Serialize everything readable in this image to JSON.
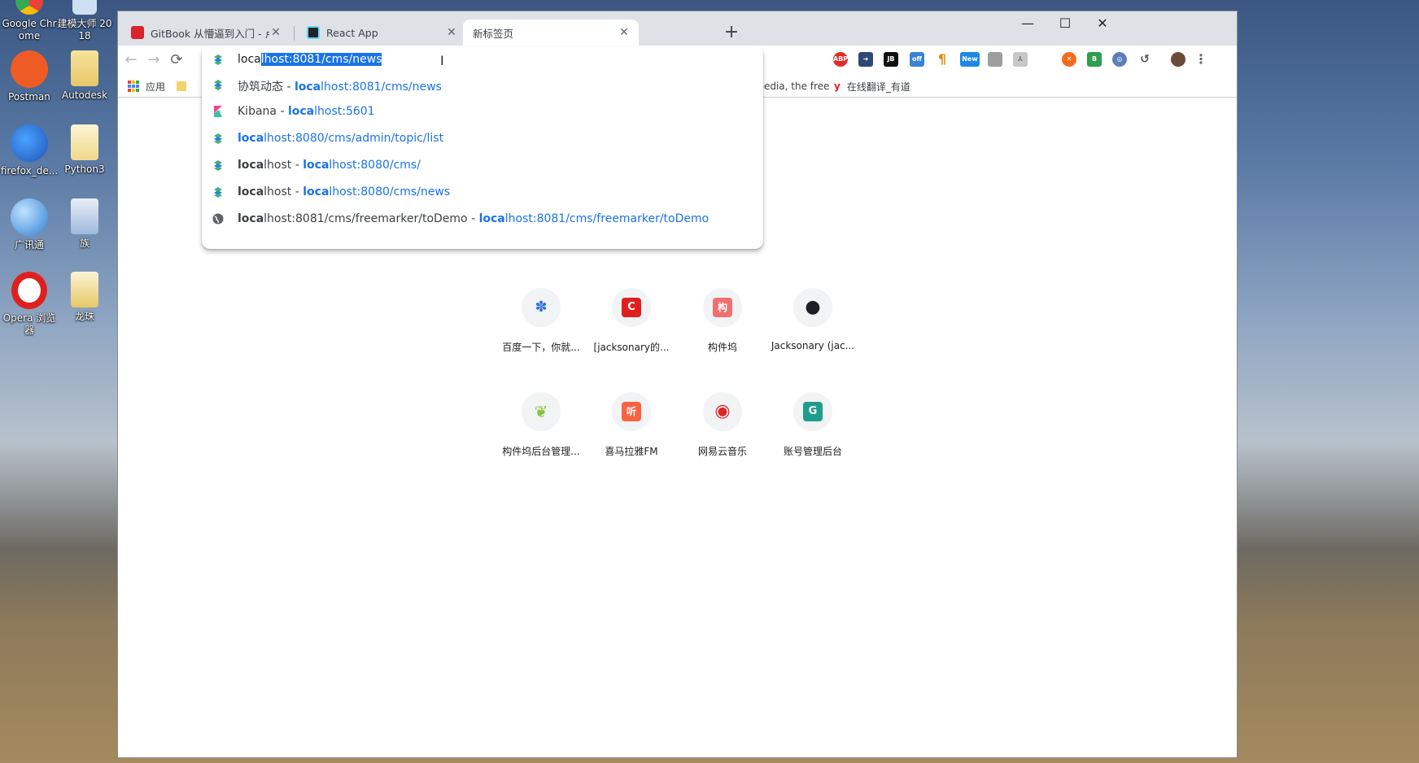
{
  "desktop": {
    "icons": [
      {
        "label": "Google Chrome",
        "color": "#f2c017"
      },
      {
        "label": "建模大师 2018",
        "color": "#d8e6f5"
      },
      {
        "label": "Postman",
        "color": "#ef5b25"
      },
      {
        "label": "Autodesk",
        "color": "#f3d36b"
      },
      {
        "label": "firefox_de...",
        "color": "#2a6fd6"
      },
      {
        "label": "Python3",
        "color": "#f3d36b"
      },
      {
        "label": "广讯通",
        "color": "#3a86d8"
      },
      {
        "label": "族",
        "color": "#6aa0d8"
      },
      {
        "label": "Opera 浏览器",
        "color": "#e0201e"
      },
      {
        "label": "龙珠",
        "color": "#f3d36b"
      }
    ]
  },
  "browser": {
    "tabs": [
      {
        "title": "GitBook 从懵逼到入门 - 卢小喵",
        "favicon_color": "#d9232d"
      },
      {
        "title": "React App",
        "favicon_color": "#20232a"
      },
      {
        "title": "新标签页",
        "favicon_color": ""
      }
    ],
    "new_tab_symbol": "+",
    "window_controls": {
      "minimize": "—",
      "maximize": "☐",
      "close": "✕"
    },
    "nav": {
      "back": "←",
      "forward": "→",
      "reload": "⟳"
    },
    "omnibox": {
      "typed": "loca",
      "selected_completion": "lhost:8081/cms/news",
      "suggestions": [
        {
          "title": "协筑动态",
          "sep": " - ",
          "url_bold": "loca",
          "url_rest": "lhost:8081/cms/news",
          "icon": "site-icon"
        },
        {
          "title": "Kibana",
          "sep": " - ",
          "url_bold": "loca",
          "url_rest": "lhost:5601",
          "icon": "kibana-icon"
        },
        {
          "title": "",
          "sep": "",
          "url_bold": "loca",
          "url_rest": "lhost:8080/cms/admin/topic/list",
          "icon": "site-icon"
        },
        {
          "title_bold": "loca",
          "title": "lhost",
          "sep": " - ",
          "url_bold": "loca",
          "url_rest": "lhost:8080/cms/",
          "icon": "site-icon"
        },
        {
          "title_bold": "loca",
          "title": "lhost",
          "sep": " - ",
          "url_bold": "loca",
          "url_rest": "lhost:8080/cms/news",
          "icon": "site-icon"
        },
        {
          "title_bold": "loca",
          "title": "lhost:8081/cms/freemarker/toDemo",
          "sep": " - ",
          "url_bold": "loca",
          "url_rest": "lhost:8081/cms/freemarker/toDemo",
          "icon": "globe-icon"
        }
      ]
    },
    "bookmarks": {
      "apps_label": "应用",
      "partial_label": "ipedia, the free",
      "youdao_label": "在线翻译_有道"
    },
    "extensions": [
      {
        "name": "adblock-icon",
        "text": "ABP",
        "color": "#e42b2b"
      },
      {
        "name": "arrow-ext-icon",
        "text": "➔",
        "color": "#2c4a73"
      },
      {
        "name": "jb-icon",
        "text": "JB",
        "color": "#111111"
      },
      {
        "name": "off-ext-icon",
        "text": "off",
        "color": "#3b82d6"
      },
      {
        "name": "pilcrow-icon",
        "text": "¶",
        "color": "#e88a00"
      },
      {
        "name": "new-ext-icon",
        "text": "New",
        "color": "#1e88e5"
      },
      {
        "name": "gray-ext-icon",
        "text": "",
        "color": "#9e9e9e"
      },
      {
        "name": "pdf-ext-icon",
        "text": "⅄",
        "color": "#c7c7c7"
      },
      {
        "name": "orange-ext-icon",
        "text": "✕",
        "color": "#f36b1d"
      },
      {
        "name": "green-ext-icon",
        "text": "B",
        "color": "#2e9e4f"
      },
      {
        "name": "owl-ext-icon",
        "text": "◎",
        "color": "#5a7fb5"
      },
      {
        "name": "history-icon",
        "text": "↺",
        "color": "#6b6b6b"
      }
    ],
    "menu_symbol": "⋮",
    "shortcuts": [
      {
        "label": "百度一下，你就...",
        "glyph": "✽",
        "color": "#2f6fe0"
      },
      {
        "label": "[jacksonary的...",
        "glyph": "C",
        "color": "#e02020"
      },
      {
        "label": "构件坞",
        "glyph": "构",
        "color": "#f07070"
      },
      {
        "label": "Jacksonary (jac...",
        "glyph": "●",
        "color": "#1b1f23"
      },
      {
        "label": "构件坞后台管理...",
        "glyph": "❦",
        "color": "#86c440"
      },
      {
        "label": "喜马拉雅FM",
        "glyph": "听",
        "color": "#f86442"
      },
      {
        "label": "网易云音乐",
        "glyph": "◉",
        "color": "#e02525"
      },
      {
        "label": "账号管理后台",
        "glyph": "G",
        "color": "#1f9d8b"
      }
    ]
  }
}
